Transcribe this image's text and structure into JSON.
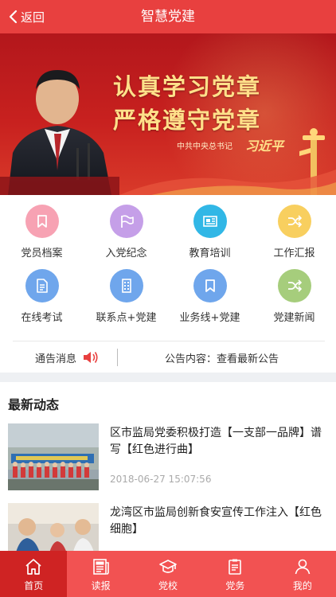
{
  "header": {
    "back_label": "返回",
    "title": "智慧党建"
  },
  "banner": {
    "slogan_line1": "认真学习党章",
    "slogan_line2": "严格遵守党章",
    "byline": "中共中央总书记",
    "signature": "习近平",
    "slide_count": 4,
    "active_slide": 1
  },
  "menu": [
    {
      "label": "党员档案",
      "icon": "bookmark-icon",
      "color": "#f7a2b3"
    },
    {
      "label": "入党纪念",
      "icon": "flag-icon",
      "color": "#c59fe8"
    },
    {
      "label": "教育培训",
      "icon": "newspaper-icon",
      "color": "#31b7e6"
    },
    {
      "label": "工作汇报",
      "icon": "shuffle-icon",
      "color": "#f8cf5f"
    },
    {
      "label": "在线考试",
      "icon": "document-icon",
      "color": "#6fa6ec"
    },
    {
      "label": "联系点+党建",
      "icon": "building-icon",
      "color": "#6fa6ec"
    },
    {
      "label": "业务线+党建",
      "icon": "bookmark-icon",
      "color": "#6fa6ec"
    },
    {
      "label": "党建新闻",
      "icon": "shuffle-icon",
      "color": "#a6cd7c"
    }
  ],
  "notice": {
    "label": "通告消息",
    "content": "公告内容：查看最新公告"
  },
  "news": {
    "heading": "最新动态",
    "items": [
      {
        "title": "区市监局党委积极打造【一支部一品牌】谱写【红色进行曲】",
        "time": "2018-06-27 15:07:56"
      },
      {
        "title": "龙湾区市监局创新食安宣传工作注入【红色细胞】",
        "time": ""
      }
    ]
  },
  "tabs": [
    {
      "label": "首页",
      "icon": "home-icon",
      "active": true
    },
    {
      "label": "读报",
      "icon": "newspaper-icon",
      "active": false
    },
    {
      "label": "党校",
      "icon": "graduation-cap-icon",
      "active": false
    },
    {
      "label": "党务",
      "icon": "clipboard-icon",
      "active": false
    },
    {
      "label": "我的",
      "icon": "user-icon",
      "active": false
    }
  ],
  "colors": {
    "primary": "#e8403f",
    "tabbar": "#f25252",
    "tab_active": "#cf2323",
    "accent_gold": "#ffe08a"
  }
}
